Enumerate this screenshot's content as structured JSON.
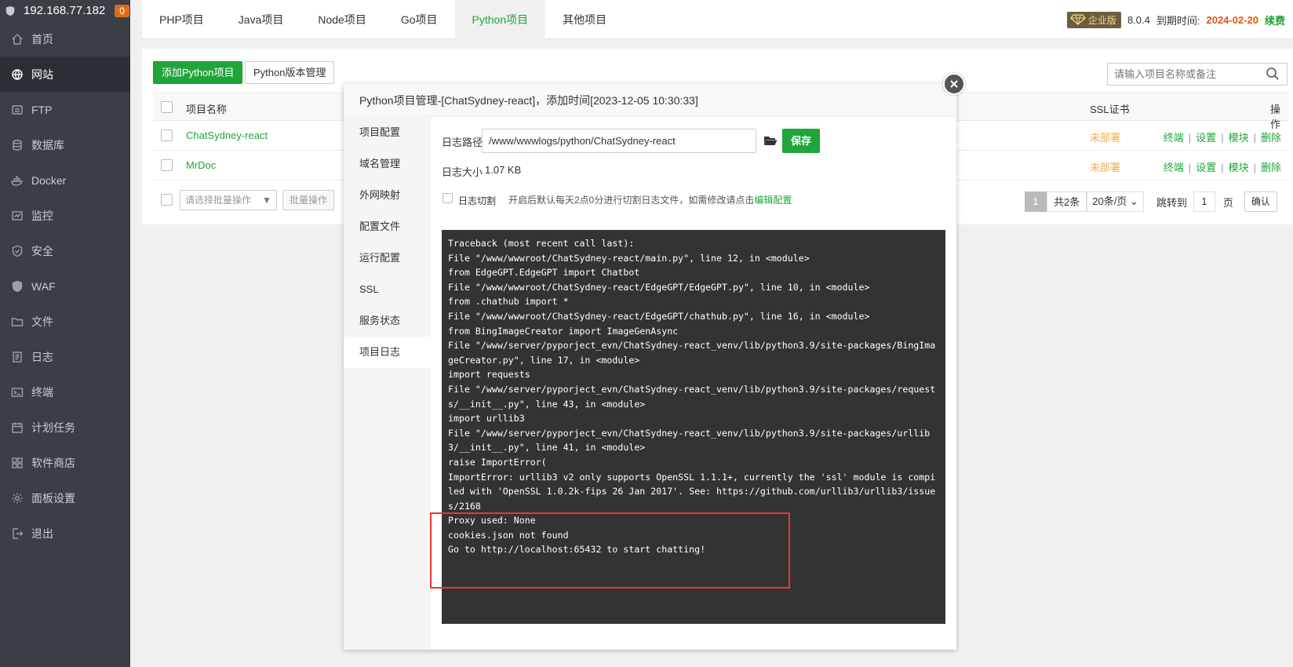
{
  "sidebar": {
    "ip": "192.168.77.182",
    "badge": "0",
    "items": [
      {
        "label": "首页",
        "icon": "home-icon"
      },
      {
        "label": "网站",
        "icon": "globe-icon"
      },
      {
        "label": "FTP",
        "icon": "ftp-icon"
      },
      {
        "label": "数据库",
        "icon": "database-icon"
      },
      {
        "label": "Docker",
        "icon": "docker-icon"
      },
      {
        "label": "监控",
        "icon": "monitor-icon"
      },
      {
        "label": "安全",
        "icon": "shield-icon"
      },
      {
        "label": "WAF",
        "icon": "waf-icon"
      },
      {
        "label": "文件",
        "icon": "folder-icon"
      },
      {
        "label": "日志",
        "icon": "log-icon"
      },
      {
        "label": "终端",
        "icon": "terminal-icon"
      },
      {
        "label": "计划任务",
        "icon": "calendar-icon"
      },
      {
        "label": "软件商店",
        "icon": "apps-icon"
      },
      {
        "label": "面板设置",
        "icon": "gear-icon"
      },
      {
        "label": "退出",
        "icon": "logout-icon"
      }
    ]
  },
  "topbar": {
    "tabs": [
      "PHP项目",
      "Java项目",
      "Node项目",
      "Go项目",
      "Python项目",
      "其他项目"
    ],
    "edition": "企业版",
    "version": "8.0.4",
    "expire_label": "到期时间:",
    "expire_date": "2024-02-20",
    "renew": "续费"
  },
  "main": {
    "add_button": "添加Python项目",
    "version_button": "Python版本管理",
    "search_placeholder": "请输入项目名称或备注",
    "columns": {
      "name": "项目名称",
      "ssl": "SSL证书",
      "ops": "操作"
    },
    "rows": [
      {
        "name": "ChatSydney-react",
        "ssl": "未部署"
      },
      {
        "name": "MrDoc",
        "ssl": "未部署"
      }
    ],
    "ops": [
      "终端",
      "设置",
      "模块",
      "删除"
    ],
    "batch_placeholder": "请选择批量操作",
    "batch_button": "批量操作",
    "pager": {
      "page": "1",
      "total": "共2条",
      "per_page": "20条/页",
      "jump_label": "跳转到",
      "jump_value": "1",
      "page_unit": "页",
      "confirm": "确认"
    }
  },
  "modal": {
    "title": "Python项目管理-[ChatSydney-react]，添加时间[2023-12-05 10:30:33]",
    "menu": [
      "项目配置",
      "域名管理",
      "外网映射",
      "配置文件",
      "运行配置",
      "SSL",
      "服务状态",
      "项目日志"
    ],
    "log_path_label": "日志路径",
    "log_path": "/www/wwwlogs/python/ChatSydney-react",
    "save": "保存",
    "log_size_label": "日志大小",
    "log_size": "1.07 KB",
    "cut_label": "日志切割",
    "cut_tip": "开启后默认每天2点0分进行切割日志文件，如需修改请点击",
    "cut_link": "编辑配置",
    "log_text": "Traceback (most recent call last):\nFile \"/www/wwwroot/ChatSydney-react/main.py\", line 12, in <module>\nfrom EdgeGPT.EdgeGPT import Chatbot\nFile \"/www/wwwroot/ChatSydney-react/EdgeGPT/EdgeGPT.py\", line 10, in <module>\nfrom .chathub import *\nFile \"/www/wwwroot/ChatSydney-react/EdgeGPT/chathub.py\", line 16, in <module>\nfrom BingImageCreator import ImageGenAsync\nFile \"/www/server/pyporject_evn/ChatSydney-react_venv/lib/python3.9/site-packages/BingImageCreator.py\", line 17, in <module>\nimport requests\nFile \"/www/server/pyporject_evn/ChatSydney-react_venv/lib/python3.9/site-packages/requests/__init__.py\", line 43, in <module>\nimport urllib3\nFile \"/www/server/pyporject_evn/ChatSydney-react_venv/lib/python3.9/site-packages/urllib3/__init__.py\", line 41, in <module>\nraise ImportError(\nImportError: urllib3 v2 only supports OpenSSL 1.1.1+, currently the 'ssl' module is compiled with 'OpenSSL 1.0.2k-fips 26 Jan 2017'. See: https://github.com/urllib3/urllib3/issues/2168\nProxy used: None\ncookies.json not found\nGo to http://localhost:65432 to start chatting!"
  },
  "colors": {
    "accent": "#20a53a",
    "sidebar": "#3a3f46",
    "console": "#333333",
    "highlight": "#e53935",
    "expire": "#e0570f"
  }
}
